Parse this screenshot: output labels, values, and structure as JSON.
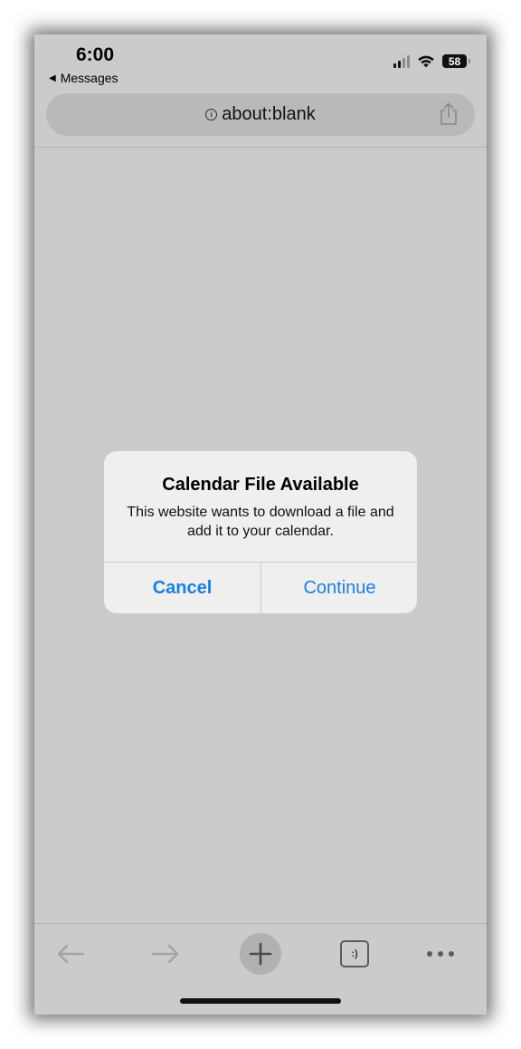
{
  "status_bar": {
    "time": "6:00",
    "back_label": "Messages",
    "battery_level": "58"
  },
  "url_bar": {
    "url": "about:blank"
  },
  "dialog": {
    "title": "Calendar File Available",
    "message": "This website wants to download a file and add it to your calendar.",
    "cancel_label": "Cancel",
    "continue_label": "Continue"
  },
  "toolbar": {
    "tabs_label": ":)"
  },
  "colors": {
    "accent": "#1a7ee6",
    "page_background": "#cbcbcb",
    "dialog_background": "#efefef"
  },
  "icons": [
    "back-arrow-icon",
    "forward-arrow-icon",
    "plus-icon",
    "tabs-icon",
    "more-icon",
    "share-icon",
    "info-icon",
    "wifi-icon",
    "signal-icon",
    "battery-icon"
  ]
}
